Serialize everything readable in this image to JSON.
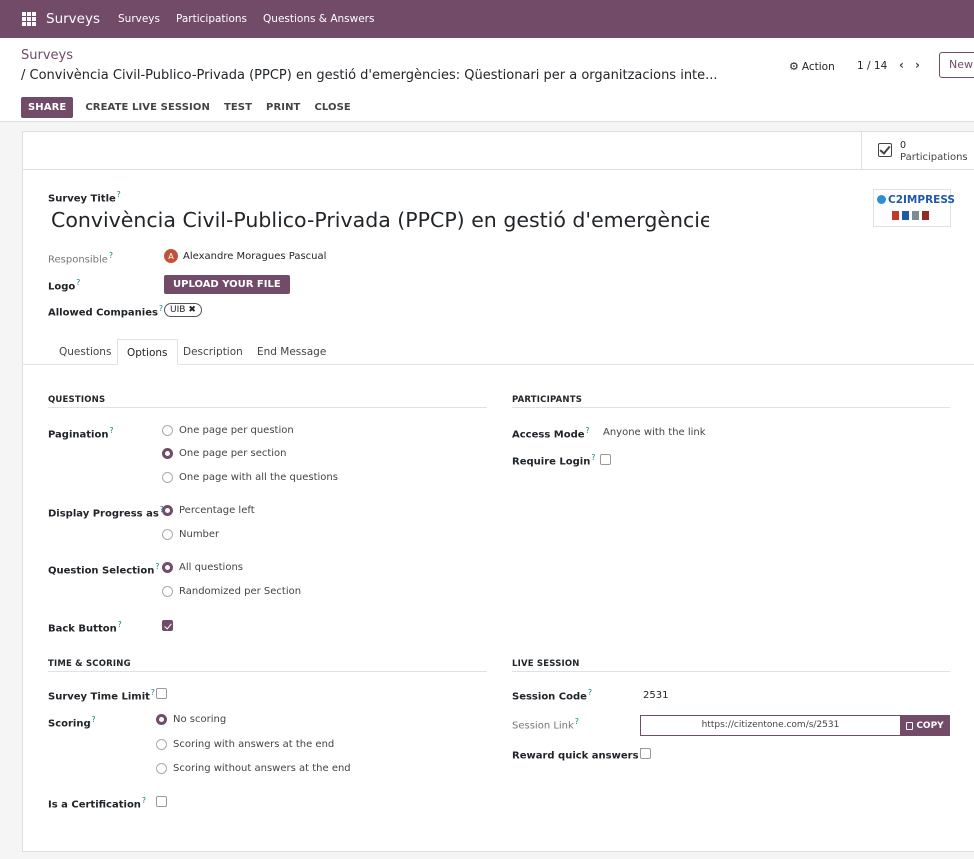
{
  "topnav": {
    "app": "Surveys",
    "menu": [
      "Surveys",
      "Participations",
      "Questions & Answers"
    ]
  },
  "control_panel": {
    "breadcrumb_root": "Surveys",
    "breadcrumb_current": "/ Convivència Civil-Publico-Privada (PPCP) en gestió d'emergències: Qüestionari per a organitzacions inte...",
    "action": "Action",
    "pager": "1 / 14",
    "new": "New",
    "buttons": {
      "share": "SHARE",
      "live": "CREATE LIVE SESSION",
      "test": "TEST",
      "print": "PRINT",
      "close": "CLOSE"
    }
  },
  "stat": {
    "count": "0",
    "label": "Participations"
  },
  "form": {
    "title_label": "Survey Title",
    "title": "Convivència Civil-Publico-Privada (PPCP) en gestió d'emergències: Qüestionari per a organitzacions interessades",
    "logo_text": "C2IMPRESS",
    "responsible_label": "Responsible",
    "responsible_initial": "A",
    "responsible": "Alexandre Moragues Pascual",
    "logo_label": "Logo",
    "upload": "UPLOAD YOUR FILE",
    "companies_label": "Allowed Companies",
    "company_tag": "UIB"
  },
  "tabs": [
    "Questions",
    "Options",
    "Description",
    "End Message"
  ],
  "questions": {
    "title": "QUESTIONS",
    "pagination_label": "Pagination",
    "pagination_options": [
      "One page per question",
      "One page per section",
      "One page with all the questions"
    ],
    "progress_label": "Display Progress as",
    "progress_options": [
      "Percentage left",
      "Number"
    ],
    "selection_label": "Question Selection",
    "selection_options": [
      "All questions",
      "Randomized per Section"
    ],
    "back_label": "Back Button"
  },
  "participants": {
    "title": "PARTICIPANTS",
    "access_label": "Access Mode",
    "access_value": "Anyone with the link",
    "login_label": "Require Login"
  },
  "time_scoring": {
    "title": "TIME & SCORING",
    "time_label": "Survey Time Limit",
    "scoring_label": "Scoring",
    "scoring_options": [
      "No scoring",
      "Scoring with answers at the end",
      "Scoring without answers at the end"
    ],
    "cert_label": "Is a Certification"
  },
  "live": {
    "title": "LIVE SESSION",
    "code_label": "Session Code",
    "code": "2531",
    "link_label": "Session Link",
    "link": "https://citizentone.com/s/2531",
    "copy": "COPY",
    "reward_label": "Reward quick answers"
  },
  "help_mark": "?",
  "colors": {
    "brand": "#714b67",
    "help": "#017e84",
    "avatar": "#c0533b"
  }
}
